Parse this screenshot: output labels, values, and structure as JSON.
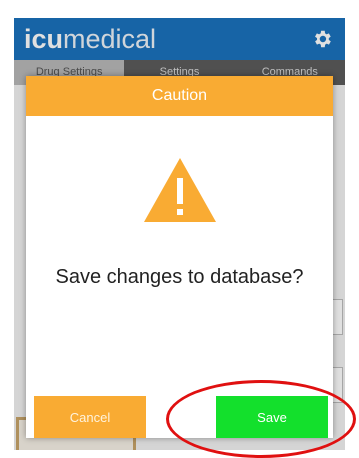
{
  "header": {
    "logo_bold": "icu",
    "logo_light": "medical",
    "settings_icon": "gear-icon"
  },
  "tabs": [
    {
      "label": "Drug Settings"
    },
    {
      "label": "Settings"
    },
    {
      "label": "Commands"
    }
  ],
  "dialog": {
    "title": "Caution",
    "icon": "warning-icon",
    "message": "Save changes to database?",
    "cancel_label": "Cancel",
    "save_label": "Save"
  },
  "colors": {
    "header_blue": "#1b72bd",
    "caution_orange": "#f9ab33",
    "save_green": "#13e02c",
    "annotation_red": "#e01010"
  }
}
